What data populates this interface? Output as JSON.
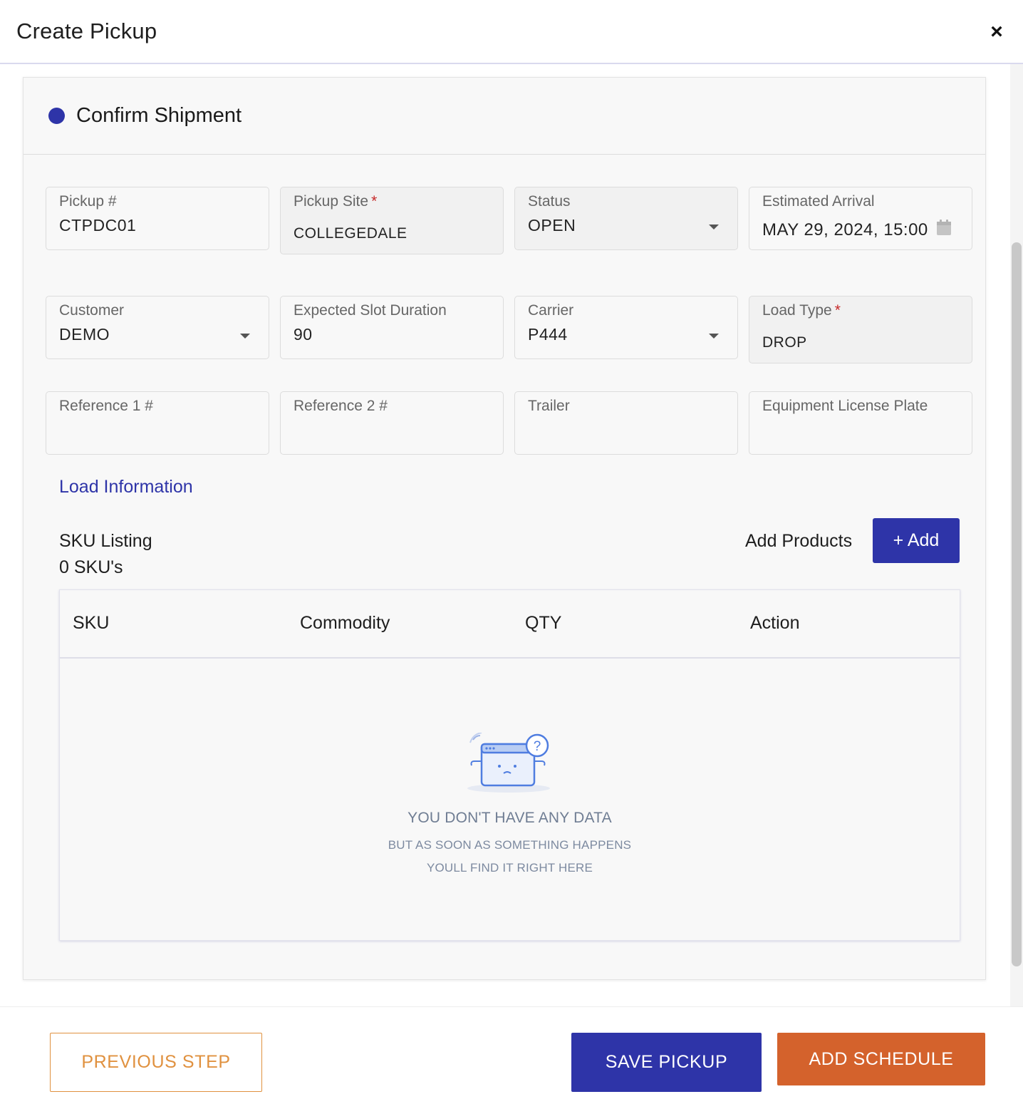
{
  "header": {
    "title": "Create Pickup",
    "close_label": "×"
  },
  "section": {
    "title": "Confirm Shipment"
  },
  "fields": {
    "pickup_number": {
      "label": "Pickup #",
      "value": "CTPDC01"
    },
    "pickup_site": {
      "label": "Pickup Site",
      "required": "*",
      "value": "COLLEGEDALE"
    },
    "status": {
      "label": "Status",
      "value": "OPEN"
    },
    "estimated_arrival": {
      "label": "Estimated Arrival",
      "value": "MAY 29, 2024, 15:00"
    },
    "customer": {
      "label": "Customer",
      "value": "DEMO"
    },
    "slot_duration": {
      "label": "Expected Slot Duration",
      "value": "90"
    },
    "carrier": {
      "label": "Carrier",
      "value": "P444"
    },
    "load_type": {
      "label": "Load Type",
      "required": "*",
      "value": "DROP"
    },
    "reference1": {
      "label": "Reference 1 #",
      "value": ""
    },
    "reference2": {
      "label": "Reference 2 #",
      "value": ""
    },
    "trailer": {
      "label": "Trailer",
      "value": ""
    },
    "equipment_plate": {
      "label": "Equipment License Plate",
      "value": ""
    }
  },
  "load_info_link": "Load Information",
  "sku": {
    "title": "SKU Listing",
    "count": "0 SKU's",
    "add_products_label": "Add Products",
    "add_button": "+ Add",
    "columns": [
      "SKU",
      "Commodity",
      "QTY",
      "Action"
    ],
    "empty_title": "YOU DON'T HAVE ANY DATA",
    "empty_line1": "BUT AS SOON AS SOMETHING HAPPENS",
    "empty_line2": "YOULL FIND IT RIGHT HERE"
  },
  "footer": {
    "previous": "PREVIOUS STEP",
    "save": "SAVE PICKUP",
    "schedule": "ADD SCHEDULE"
  },
  "colors": {
    "primary": "#2e34a8",
    "accent_orange": "#d4622c",
    "outline_orange": "#e0913f",
    "required": "#c62828"
  },
  "icons": {
    "close": "close-icon",
    "calendar": "calendar-icon",
    "dropdown": "chevron-down-icon",
    "empty": "empty-state-illustration"
  }
}
